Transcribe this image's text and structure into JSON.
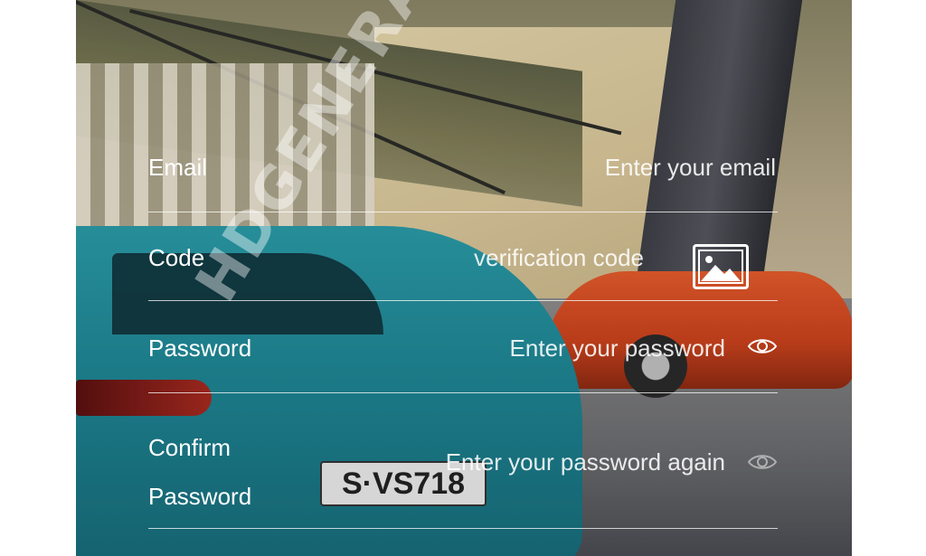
{
  "background": {
    "watermark": "HDGENERAL.BLOGSPOT",
    "plate_text": "S·VS718"
  },
  "form": {
    "email": {
      "label": "Email",
      "placeholder": "Enter your email"
    },
    "code": {
      "label": "Code",
      "placeholder": "verification code",
      "captcha_icon": "image-icon"
    },
    "password": {
      "label": "Password",
      "placeholder": "Enter your password",
      "toggle_icon": "eye-icon"
    },
    "confirm": {
      "label": "Confirm Password",
      "placeholder": "Enter your password again",
      "toggle_icon": "eye-icon"
    }
  },
  "colors": {
    "text": "#ffffff",
    "divider": "rgba(255,255,255,0.75)"
  }
}
